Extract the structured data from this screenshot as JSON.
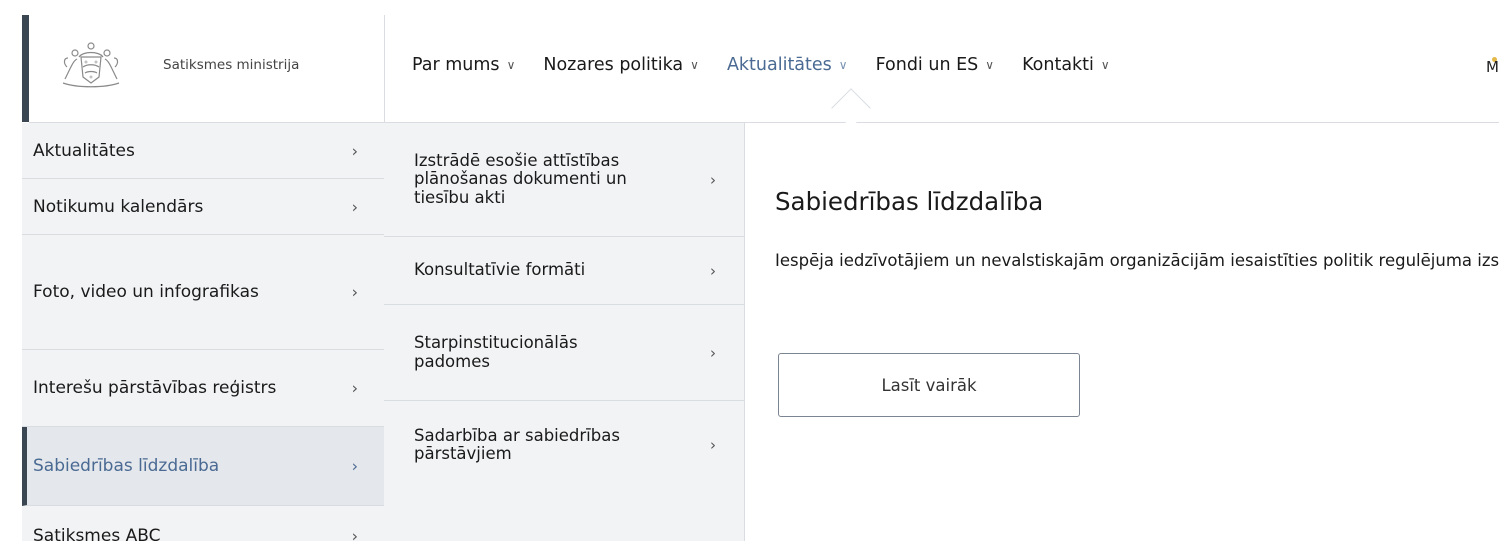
{
  "brand": {
    "name": "Satiksmes ministrija"
  },
  "nav": {
    "items": [
      {
        "label": "Par mums"
      },
      {
        "label": "Nozares politika"
      },
      {
        "label": "Aktualitātes"
      },
      {
        "label": "Fondi un ES"
      },
      {
        "label": "Kontakti"
      }
    ],
    "active_index": 2,
    "corner_text": "M"
  },
  "submenu_level1": {
    "items": [
      {
        "label": "Aktualitātes"
      },
      {
        "label": "Notikumu kalendārs"
      },
      {
        "label": "Foto, video un infografikas"
      },
      {
        "label": "Interešu pārstāvības reģistrs"
      },
      {
        "label": "Sabiedrības līdzdalība"
      },
      {
        "label": "Satiksmes ABC"
      }
    ],
    "active_index": 4
  },
  "submenu_level2": {
    "items": [
      {
        "label": "Izstrādē esošie attīstības plānošanas dokumenti un tiesību akti"
      },
      {
        "label": "Konsultatīvie formāti"
      },
      {
        "label": "Starpinstitucionālās padomes"
      },
      {
        "label": "Sadarbība ar sabiedrības pārstāvjiem"
      }
    ]
  },
  "content": {
    "title": "Sabiedrības līdzdalība",
    "description": "Iespēja iedzīvotājiem un nevalstiskajām organizācijām iesaistīties politik regulējuma izstrādē.",
    "button_label": "Lasīt vairāk"
  },
  "icons": {
    "chevron": "chevron-right-icon",
    "dropdown": "chevron-down-icon",
    "logo": "latvian-coat-of-arms"
  },
  "colors": {
    "accent": "#4a6a93",
    "sidebar_bg": "#f2f3f5",
    "border": "#d9dde2",
    "dark_bar": "#3b4653"
  }
}
